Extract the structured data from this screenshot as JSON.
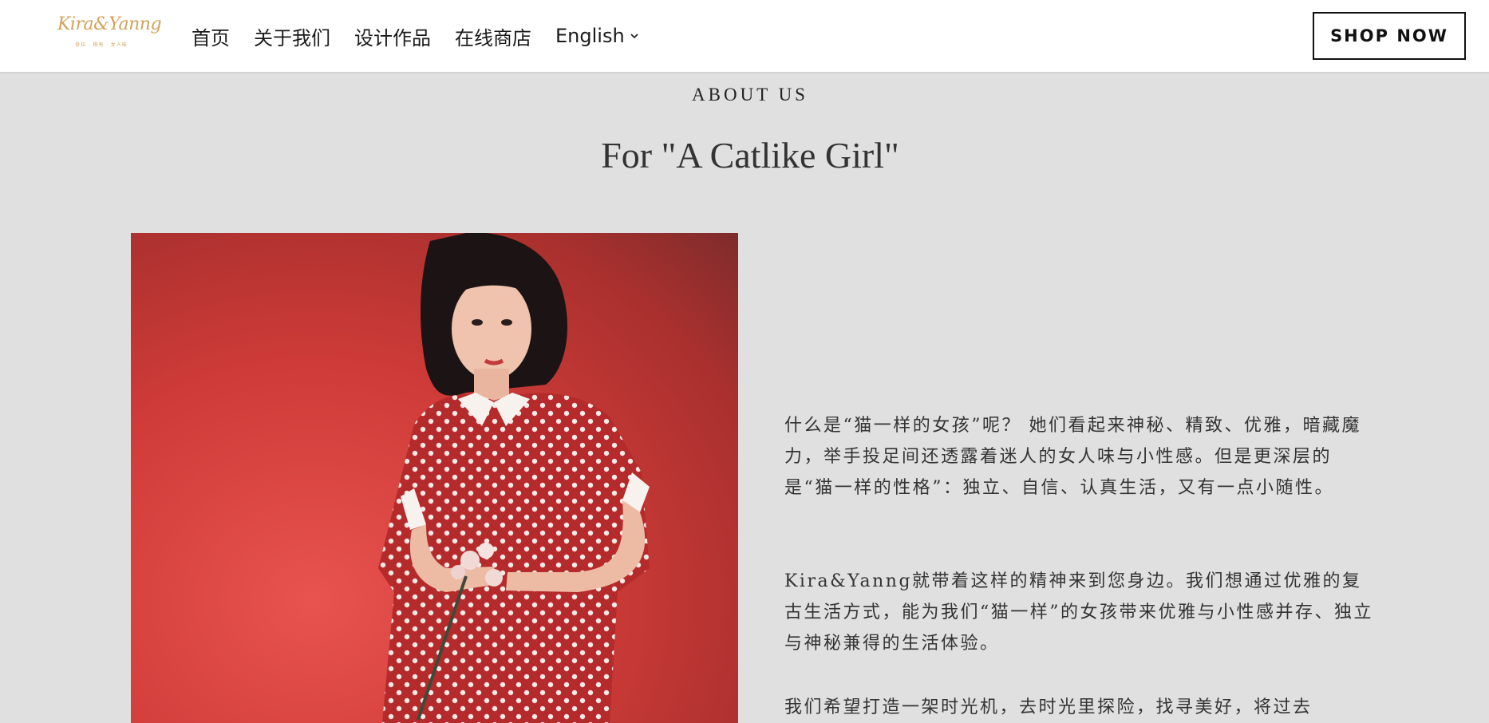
{
  "header": {
    "logo": {
      "wordmark": "Kira&Yanng",
      "tagline": "奇拉 · 杨有 · 女人味"
    },
    "nav": [
      {
        "label": "首页"
      },
      {
        "label": "关于我们"
      },
      {
        "label": "设计作品"
      },
      {
        "label": "在线商店"
      },
      {
        "label": "English"
      }
    ],
    "shop_button": "SHOP NOW"
  },
  "section": {
    "eyebrow": "ABOUT US",
    "title": "For \"A Catlike Girl\""
  },
  "paragraphs": [
    "什么是“猫一样的女孩”呢？ 她们看起来神秘、精致、优雅，暗藏魔力，举手投足间还透露着迷人的女人味与小性感。但是更深层的是“猫一样的性格”：独立、自信、认真生活，又有一点小随性。",
    "Kira&Yanng就带着这样的精神来到您身边。我们想通过优雅的复古生活方式，能为我们“猫一样”的女孩带来优雅与小性感并存、独立与神秘兼得的生活体验。",
    "我们希望打造一架时光机，去时光里探险，找寻美好，将过去"
  ],
  "colors": {
    "page_bg": "#e0e0e0",
    "header_bg": "#ffffff",
    "logo_gold": "#d4a25a",
    "photo_red": "#cf3b38"
  }
}
